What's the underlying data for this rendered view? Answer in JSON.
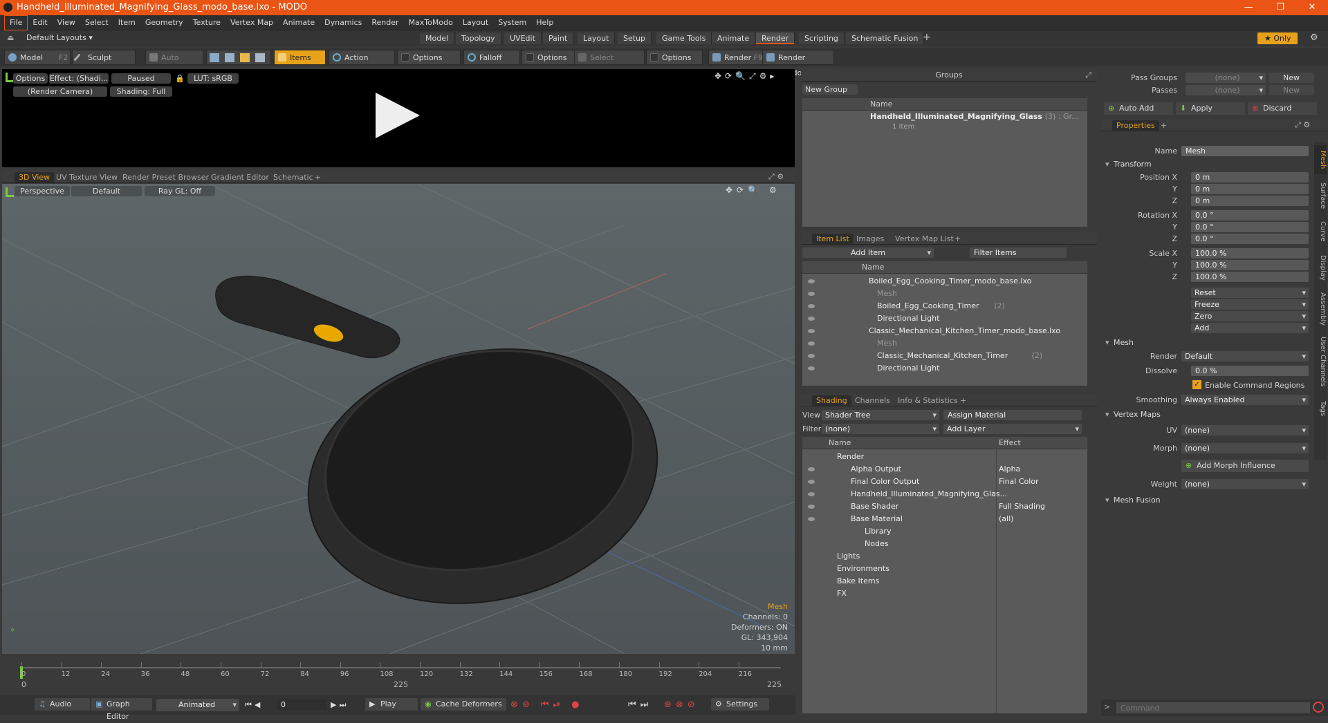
{
  "window": {
    "title": "Handheld_Illuminated_Magnifying_Glass_modo_base.lxo - MODO"
  },
  "menu": [
    "File",
    "Edit",
    "View",
    "Select",
    "Item",
    "Geometry",
    "Texture",
    "Vertex Map",
    "Animate",
    "Dynamics",
    "Render",
    "MaxToModo",
    "Layout",
    "System",
    "Help"
  ],
  "layout": {
    "preset": "Default Layouts",
    "tabs": [
      "Model",
      "Topology",
      "UVEdit",
      "Paint",
      "Layout",
      "Setup",
      "Game Tools",
      "Animate",
      "Render",
      "Scripting",
      "Schematic Fusion"
    ],
    "selected_tab": "Render",
    "only_label": "Only"
  },
  "toolbar": {
    "model": "Model",
    "model_key": "F2",
    "sculpt": "Sculpt",
    "auto_select": "Auto Select",
    "items": "Items",
    "action_center": "Action Center",
    "options1": "Options",
    "falloff": "Falloff",
    "options2": "Options",
    "select_through": "Select Through",
    "options3": "Options",
    "render": "Render",
    "render_key": "F9",
    "render_window": "Render Window"
  },
  "render_view": {
    "options": "Options",
    "effect": "Effect: (Shadi...",
    "paused": "Paused",
    "lut": "LUT: sRGB",
    "camera": "(Render Camera)",
    "shading": "Shading: Full"
  },
  "view_tabs": [
    "3D View",
    "UV Texture View",
    "Render Preset Browser",
    "Gradient Editor",
    "Schematic"
  ],
  "viewport": {
    "perspective": "Perspective",
    "default": "Default",
    "raygl": "Ray GL: Off",
    "info": {
      "mesh": "Mesh",
      "channels": "Channels: 0",
      "deformers": "Deformers: ON",
      "gl": "GL: 343,904",
      "scale": "10 mm"
    }
  },
  "timeline": {
    "ticks": [
      "0",
      "12",
      "24",
      "36",
      "48",
      "60",
      "72",
      "84",
      "96",
      "108",
      "120",
      "132",
      "144",
      "156",
      "168",
      "180",
      "192",
      "204",
      "216"
    ],
    "start": "0",
    "mid": "225",
    "end": "225"
  },
  "transport": {
    "audio": "Audio",
    "graph_editor": "Graph Editor",
    "animated": "Animated",
    "frame": "0",
    "play": "Play",
    "cache": "Cache Deformers",
    "settings": "Settings"
  },
  "groups": {
    "title": "Groups",
    "new_group": "New Group",
    "col_name": "Name",
    "item": "Handheld_Illuminated_Magnifying_Glass",
    "item_suffix": "(3) : Gr...",
    "item_sub": "1 Item"
  },
  "item_list": {
    "tabs": [
      "Item List",
      "Images",
      "Vertex Map List"
    ],
    "add_item": "Add Item",
    "filter": "Filter Items",
    "col_name": "Name",
    "rows": [
      {
        "label": "Boiled_Egg_Cooking_Timer_modo_base.lxo",
        "indent": 0,
        "dim": false
      },
      {
        "label": "Mesh",
        "indent": 2,
        "dim": true
      },
      {
        "label": "Boiled_Egg_Cooking_Timer",
        "indent": 2,
        "dim": false,
        "suffix": "(2)"
      },
      {
        "label": "Directional Light",
        "indent": 2,
        "dim": false
      },
      {
        "label": "Classic_Mechanical_Kitchen_Timer_modo_base.lxo",
        "indent": 0,
        "dim": false
      },
      {
        "label": "Mesh",
        "indent": 2,
        "dim": true
      },
      {
        "label": "Classic_Mechanical_Kitchen_Timer",
        "indent": 2,
        "dim": false,
        "suffix": "(2)"
      },
      {
        "label": "Directional Light",
        "indent": 2,
        "dim": false
      }
    ]
  },
  "shading": {
    "tabs": [
      "Shading",
      "Channels",
      "Info & Statistics"
    ],
    "view_label": "View",
    "view_value": "Shader Tree",
    "assign": "Assign Material",
    "filter_label": "Filter",
    "filter_value": "(none)",
    "add_layer": "Add Layer",
    "col_name": "Name",
    "col_effect": "Effect",
    "rows": [
      {
        "name": "Render",
        "effect": ""
      },
      {
        "name": "Alpha Output",
        "effect": "Alpha"
      },
      {
        "name": "Final Color Output",
        "effect": "Final Color"
      },
      {
        "name": "Handheld_Illuminated_Magnifying_Glas...",
        "effect": ""
      },
      {
        "name": "Base Shader",
        "effect": "Full Shading"
      },
      {
        "name": "Base Material",
        "effect": "(all)"
      },
      {
        "name": "Library",
        "effect": ""
      },
      {
        "name": "Nodes",
        "effect": ""
      },
      {
        "name": "Lights",
        "effect": ""
      },
      {
        "name": "Environments",
        "effect": ""
      },
      {
        "name": "Bake Items",
        "effect": ""
      },
      {
        "name": "FX",
        "effect": ""
      }
    ]
  },
  "properties": {
    "pass_groups": "Pass Groups",
    "passes": "Passes",
    "none": "(none)",
    "new": "New",
    "auto_add": "Auto Add",
    "apply": "Apply",
    "discard": "Discard",
    "tab": "Properties",
    "name_label": "Name",
    "name_value": "Mesh",
    "transform": "Transform",
    "position_label": "Position X",
    "rotation_label": "Rotation X",
    "scale_label": "Scale X",
    "y": "Y",
    "z": "Z",
    "pos": [
      "0 m",
      "0 m",
      "0 m"
    ],
    "rot": [
      "0.0 °",
      "0.0 °",
      "0.0 °"
    ],
    "scl": [
      "100.0 %",
      "100.0 %",
      "100.0 %"
    ],
    "reset": "Reset",
    "freeze": "Freeze",
    "zero": "Zero",
    "add": "Add",
    "mesh_section": "Mesh",
    "render_label": "Render",
    "render_value": "Default",
    "dissolve_label": "Dissolve",
    "dissolve_value": "0.0 %",
    "enable_cmd": "Enable Command Regions",
    "smoothing_label": "Smoothing",
    "smoothing_value": "Always Enabled",
    "vertex_maps": "Vertex Maps",
    "uv_label": "UV",
    "morph_label": "Morph",
    "add_morph": "Add Morph Influence",
    "weight_label": "Weight",
    "mesh_fusion": "Mesh Fusion",
    "side_tabs": [
      "Mesh",
      "Surface",
      "Curve",
      "Display",
      "Assembly",
      "User Channels",
      "Tags"
    ]
  },
  "command": {
    "placeholder": "Command"
  }
}
